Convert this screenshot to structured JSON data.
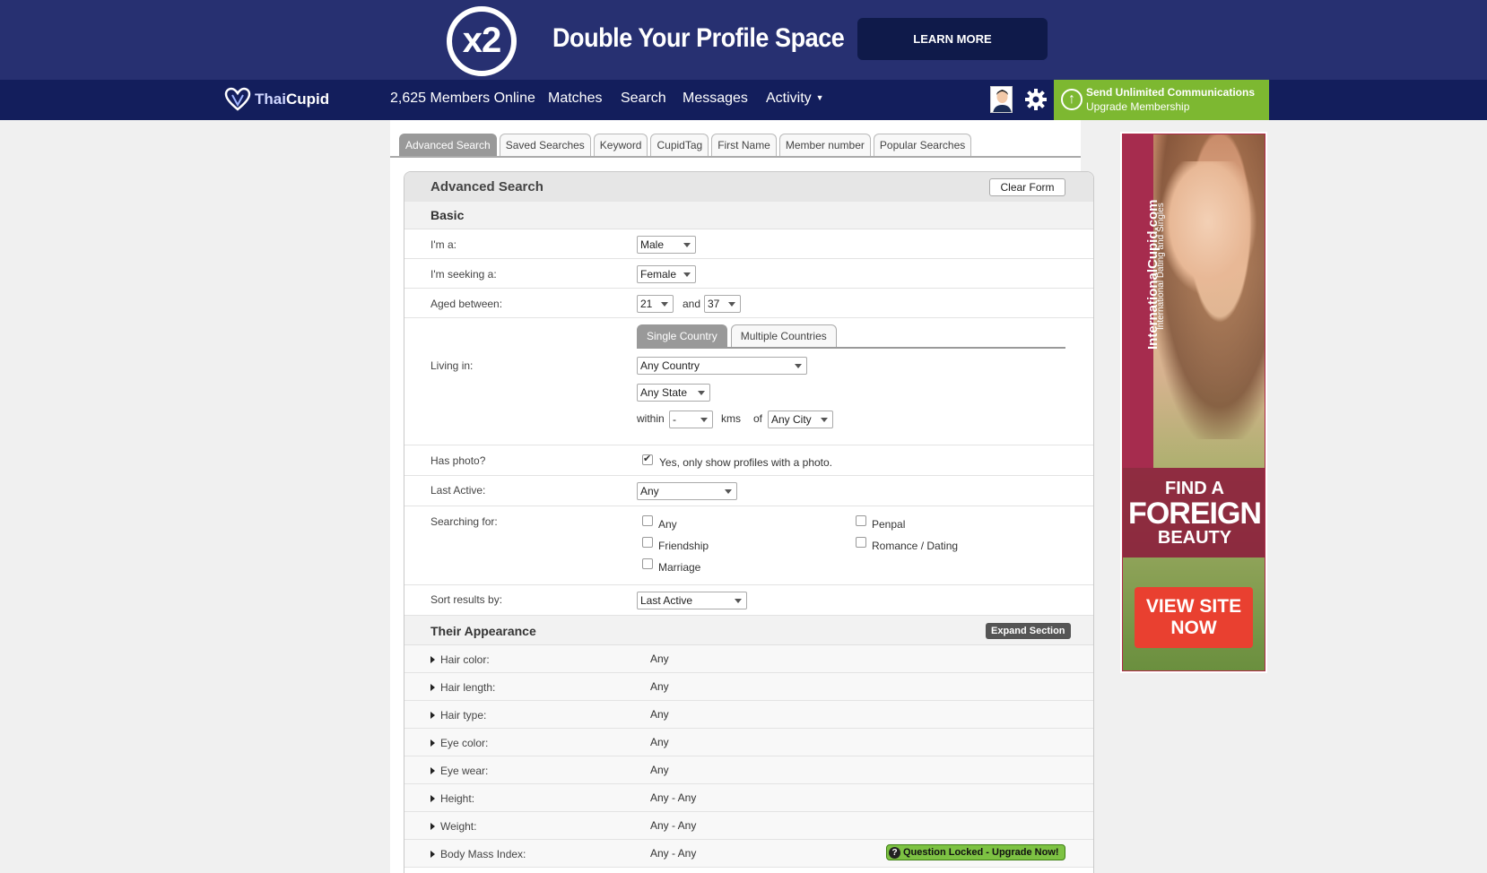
{
  "banner": {
    "badge": "x2",
    "title": "Double Your Profile Space",
    "cta": "LEARN MORE"
  },
  "nav": {
    "logo_thai": "Thai",
    "logo_cupid": "Cupid",
    "members_online": "2,625 Members Online",
    "matches": "Matches",
    "search": "Search",
    "messages": "Messages",
    "activity": "Activity",
    "upgrade_line1": "Send Unlimited Communications",
    "upgrade_line2": "Upgrade Membership"
  },
  "tabs": [
    "Advanced Search",
    "Saved Searches",
    "Keyword",
    "CupidTag",
    "First Name",
    "Member number",
    "Popular Searches"
  ],
  "panel": {
    "title": "Advanced Search",
    "clear_form": "Clear Form",
    "basic": "Basic",
    "im_a_label": "I'm a:",
    "im_a_value": "Male",
    "seeking_label": "I'm seeking a:",
    "seeking_value": "Female",
    "aged_label": "Aged between:",
    "age_min": "21",
    "and": "and",
    "age_max": "37",
    "living_label": "Living in:",
    "single_country": "Single Country",
    "multiple_countries": "Multiple Countries",
    "country": "Any Country",
    "state": "Any State",
    "within": "within",
    "distance": "-",
    "kms": "kms",
    "of": "of",
    "city": "Any City",
    "photo_label": "Has photo?",
    "photo_text": "Yes, only show profiles with a photo.",
    "last_active_label": "Last Active:",
    "last_active_value": "Any",
    "searching_label": "Searching for:",
    "searching_options": [
      "Any",
      "Penpal",
      "Friendship",
      "Romance / Dating",
      "Marriage"
    ],
    "sort_label": "Sort results by:",
    "sort_value": "Last Active"
  },
  "appearance": {
    "title": "Their Appearance",
    "expand": "Expand Section",
    "rows": [
      {
        "label": "Hair color:",
        "value": "Any"
      },
      {
        "label": "Hair length:",
        "value": "Any"
      },
      {
        "label": "Hair type:",
        "value": "Any"
      },
      {
        "label": "Eye color:",
        "value": "Any"
      },
      {
        "label": "Eye wear:",
        "value": "Any"
      },
      {
        "label": "Height:",
        "value": "Any - Any"
      },
      {
        "label": "Weight:",
        "value": "Any - Any"
      },
      {
        "label": "Body Mass Index:",
        "value": "Any - Any"
      }
    ],
    "locked": "Question Locked - Upgrade Now!"
  },
  "ad": {
    "site": "InternationalCupid.com",
    "sub": "International Dating and Singles",
    "line1": "FIND A",
    "line2": "FOREIGN",
    "line3": "BEAUTY",
    "cta": "VIEW SITE NOW"
  },
  "colors": {
    "banner": "#273071",
    "nav": "#131e5c",
    "upgrade": "#7db831"
  }
}
